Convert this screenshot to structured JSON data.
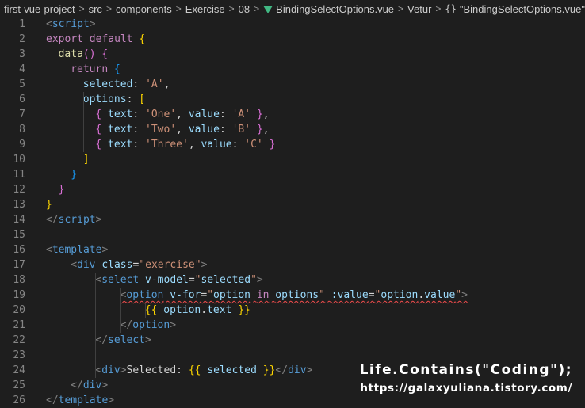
{
  "breadcrumb": {
    "items": [
      "first-vue-project",
      "src",
      "components",
      "Exercise",
      "08",
      "BindingSelectOptions.vue",
      "Vetur",
      "\"BindingSelectOptions.vue\""
    ],
    "separator": ">",
    "file_icon": "vue-icon",
    "symbol_icon": "braces-icon",
    "symbol_glyph": "{}"
  },
  "watermark": {
    "title": "Life.Contains(\"Coding\");",
    "url": "https://galaxyuliana.tistory.com/"
  },
  "lines": [
    {
      "n": "1",
      "c": [
        [
          "ang",
          "<"
        ],
        [
          "tag",
          "script"
        ],
        [
          "ang",
          ">"
        ]
      ]
    },
    {
      "n": "2",
      "c": [
        [
          "kw",
          "export"
        ],
        [
          "pun",
          " "
        ],
        [
          "kw",
          "default"
        ],
        [
          "pun",
          " "
        ],
        [
          "b1",
          "{"
        ]
      ]
    },
    {
      "n": "3",
      "c": [
        [
          "fn",
          "data"
        ],
        [
          "b2",
          "()"
        ],
        [
          "pun",
          " "
        ],
        [
          "b2",
          "{"
        ]
      ]
    },
    {
      "n": "4",
      "c": [
        [
          "kw",
          "return"
        ],
        [
          "pun",
          " "
        ],
        [
          "b3",
          "{"
        ]
      ]
    },
    {
      "n": "5",
      "c": [
        [
          "prop",
          "selected"
        ],
        [
          "pun",
          ": "
        ],
        [
          "str",
          "'A'"
        ],
        [
          "pun",
          ","
        ]
      ]
    },
    {
      "n": "6",
      "c": [
        [
          "prop",
          "options"
        ],
        [
          "pun",
          ": "
        ],
        [
          "b1",
          "["
        ]
      ]
    },
    {
      "n": "7",
      "c": [
        [
          "b2",
          "{"
        ],
        [
          "pun",
          " "
        ],
        [
          "prop",
          "text"
        ],
        [
          "pun",
          ": "
        ],
        [
          "str",
          "'One'"
        ],
        [
          "pun",
          ", "
        ],
        [
          "prop",
          "value"
        ],
        [
          "pun",
          ": "
        ],
        [
          "str",
          "'A'"
        ],
        [
          "pun",
          " "
        ],
        [
          "b2",
          "}"
        ],
        [
          "pun",
          ","
        ]
      ]
    },
    {
      "n": "8",
      "c": [
        [
          "b2",
          "{"
        ],
        [
          "pun",
          " "
        ],
        [
          "prop",
          "text"
        ],
        [
          "pun",
          ": "
        ],
        [
          "str",
          "'Two'"
        ],
        [
          "pun",
          ", "
        ],
        [
          "prop",
          "value"
        ],
        [
          "pun",
          ": "
        ],
        [
          "str",
          "'B'"
        ],
        [
          "pun",
          " "
        ],
        [
          "b2",
          "}"
        ],
        [
          "pun",
          ","
        ]
      ]
    },
    {
      "n": "9",
      "c": [
        [
          "b2",
          "{"
        ],
        [
          "pun",
          " "
        ],
        [
          "prop",
          "text"
        ],
        [
          "pun",
          ": "
        ],
        [
          "str",
          "'Three'"
        ],
        [
          "pun",
          ", "
        ],
        [
          "prop",
          "value"
        ],
        [
          "pun",
          ": "
        ],
        [
          "str",
          "'C'"
        ],
        [
          "pun",
          " "
        ],
        [
          "b2",
          "}"
        ]
      ]
    },
    {
      "n": "10",
      "c": [
        [
          "b1",
          "]"
        ]
      ]
    },
    {
      "n": "11",
      "c": [
        [
          "b3",
          "}"
        ]
      ]
    },
    {
      "n": "12",
      "c": [
        [
          "b2",
          "}"
        ]
      ]
    },
    {
      "n": "13",
      "c": [
        [
          "b1",
          "}"
        ]
      ]
    },
    {
      "n": "14",
      "c": [
        [
          "ang",
          "</"
        ],
        [
          "tag",
          "script"
        ],
        [
          "ang",
          ">"
        ]
      ]
    },
    {
      "n": "15",
      "c": []
    },
    {
      "n": "16",
      "c": [
        [
          "ang",
          "<"
        ],
        [
          "tag",
          "template"
        ],
        [
          "ang",
          ">"
        ]
      ]
    },
    {
      "n": "17",
      "c": [
        [
          "ang",
          "<"
        ],
        [
          "tag",
          "div"
        ],
        [
          "pun",
          " "
        ],
        [
          "attr",
          "class"
        ],
        [
          "pun",
          "="
        ],
        [
          "str",
          "\"exercise\""
        ],
        [
          "ang",
          ">"
        ]
      ]
    },
    {
      "n": "18",
      "c": [
        [
          "ang",
          "<"
        ],
        [
          "tag",
          "select"
        ],
        [
          "pun",
          " "
        ],
        [
          "attr",
          "v-model"
        ],
        [
          "pun",
          "="
        ],
        [
          "str",
          "\""
        ],
        [
          "prop",
          "selected"
        ],
        [
          "str",
          "\""
        ],
        [
          "ang",
          ">"
        ]
      ]
    },
    {
      "n": "19",
      "c": [
        [
          "ang",
          "<"
        ],
        [
          "tag",
          "option"
        ],
        [
          "pun",
          " "
        ],
        [
          "attr",
          "v-for"
        ],
        [
          "pun",
          "="
        ],
        [
          "str",
          "\""
        ],
        [
          "prop",
          "option"
        ],
        [
          "pun",
          " "
        ],
        [
          "kw",
          "in"
        ],
        [
          "pun",
          " "
        ],
        [
          "prop",
          "options"
        ],
        [
          "str",
          "\""
        ],
        [
          "pun",
          " "
        ],
        [
          "attr",
          ":value"
        ],
        [
          "pun",
          "="
        ],
        [
          "str",
          "\""
        ],
        [
          "prop",
          "option"
        ],
        [
          "pun",
          "."
        ],
        [
          "prop",
          "value"
        ],
        [
          "str",
          "\""
        ],
        [
          "ang",
          ">"
        ]
      ],
      "squiggle": true
    },
    {
      "n": "20",
      "c": [
        [
          "b1",
          "{{"
        ],
        [
          "pun",
          " "
        ],
        [
          "prop",
          "option"
        ],
        [
          "pun",
          "."
        ],
        [
          "prop",
          "text"
        ],
        [
          "pun",
          " "
        ],
        [
          "b1",
          "}}"
        ]
      ]
    },
    {
      "n": "21",
      "c": [
        [
          "ang",
          "</"
        ],
        [
          "tag",
          "option"
        ],
        [
          "ang",
          ">"
        ]
      ]
    },
    {
      "n": "22",
      "c": [
        [
          "ang",
          "</"
        ],
        [
          "tag",
          "select"
        ],
        [
          "ang",
          ">"
        ]
      ]
    },
    {
      "n": "23",
      "c": []
    },
    {
      "n": "24",
      "c": [
        [
          "ang",
          "<"
        ],
        [
          "tag",
          "div"
        ],
        [
          "ang",
          ">"
        ],
        [
          "pun",
          "Selected: "
        ],
        [
          "b1",
          "{{"
        ],
        [
          "pun",
          " "
        ],
        [
          "prop",
          "selected"
        ],
        [
          "pun",
          " "
        ],
        [
          "b1",
          "}}"
        ],
        [
          "ang",
          "</"
        ],
        [
          "tag",
          "div"
        ],
        [
          "ang",
          ">"
        ]
      ]
    },
    {
      "n": "25",
      "c": [
        [
          "ang",
          "</"
        ],
        [
          "tag",
          "div"
        ],
        [
          "ang",
          ">"
        ]
      ]
    },
    {
      "n": "26",
      "c": [
        [
          "ang",
          "</"
        ],
        [
          "tag",
          "template"
        ],
        [
          "ang",
          ">"
        ]
      ]
    }
  ]
}
